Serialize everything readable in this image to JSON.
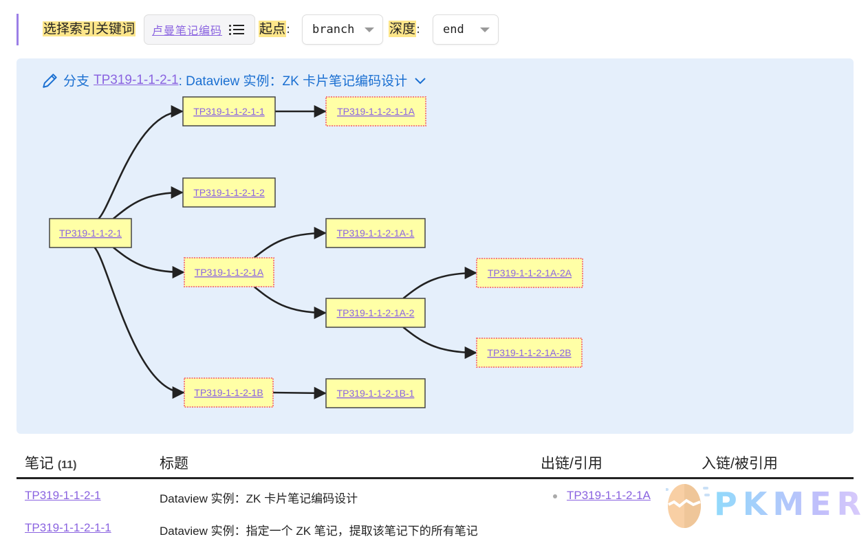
{
  "toolbar": {
    "keyword_label": "选择索引关键词",
    "keyword_value": "卢曼笔记编码",
    "start_label": "起点",
    "start_value": "branch",
    "depth_label": "深度",
    "depth_value": "end",
    "colon": ":",
    "list_icon": "list-icon"
  },
  "panel": {
    "prefix": "分支",
    "link": "TP319-1-1-2-1",
    "title": ": Dataview 实例：ZK 卡片笔记编码设计",
    "icons": {
      "edit": "pencil-icon",
      "expand": "chevron-down-icon"
    }
  },
  "graph": {
    "nodes": [
      {
        "id": "TP319-1-1-2-1",
        "label": "TP319-1-1-2-1",
        "dashed": false
      },
      {
        "id": "TP319-1-1-2-1-1",
        "label": "TP319-1-1-2-1-1",
        "dashed": false
      },
      {
        "id": "TP319-1-1-2-1-1A",
        "label": "TP319-1-1-2-1-1A",
        "dashed": true
      },
      {
        "id": "TP319-1-1-2-1-2",
        "label": "TP319-1-1-2-1-2",
        "dashed": false
      },
      {
        "id": "TP319-1-1-2-1A",
        "label": "TP319-1-1-2-1A",
        "dashed": true
      },
      {
        "id": "TP319-1-1-2-1A-1",
        "label": "TP319-1-1-2-1A-1",
        "dashed": false
      },
      {
        "id": "TP319-1-1-2-1A-2",
        "label": "TP319-1-1-2-1A-2",
        "dashed": false
      },
      {
        "id": "TP319-1-1-2-1A-2A",
        "label": "TP319-1-1-2-1A-2A",
        "dashed": true
      },
      {
        "id": "TP319-1-1-2-1A-2B",
        "label": "TP319-1-1-2-1A-2B",
        "dashed": true
      },
      {
        "id": "TP319-1-1-2-1B",
        "label": "TP319-1-1-2-1B",
        "dashed": true
      },
      {
        "id": "TP319-1-1-2-1B-1",
        "label": "TP319-1-1-2-1B-1",
        "dashed": false
      }
    ],
    "edges": [
      [
        "TP319-1-1-2-1",
        "TP319-1-1-2-1-1"
      ],
      [
        "TP319-1-1-2-1-1",
        "TP319-1-1-2-1-1A"
      ],
      [
        "TP319-1-1-2-1",
        "TP319-1-1-2-1-2"
      ],
      [
        "TP319-1-1-2-1",
        "TP319-1-1-2-1A"
      ],
      [
        "TP319-1-1-2-1A",
        "TP319-1-1-2-1A-1"
      ],
      [
        "TP319-1-1-2-1A",
        "TP319-1-1-2-1A-2"
      ],
      [
        "TP319-1-1-2-1A-2",
        "TP319-1-1-2-1A-2A"
      ],
      [
        "TP319-1-1-2-1A-2",
        "TP319-1-1-2-1A-2B"
      ],
      [
        "TP319-1-1-2-1",
        "TP319-1-1-2-1B"
      ],
      [
        "TP319-1-1-2-1B",
        "TP319-1-1-2-1B-1"
      ]
    ],
    "colors": {
      "fill": "#ffffa6",
      "border": "#444444",
      "dashed_border": "#f47c7c",
      "edge": "#222222",
      "text": "#8a63e0"
    }
  },
  "table": {
    "headers": {
      "note": "笔记",
      "count": "(11)",
      "title": "标题",
      "outlinks": "出链/引用",
      "inlinks": "入链/被引用"
    },
    "rows": [
      {
        "note": "TP319-1-1-2-1",
        "title": "Dataview 实例：ZK 卡片笔记编码设计",
        "outlinks": [
          "TP319-1-1-2-1A"
        ]
      },
      {
        "note": "TP319-1-1-2-1-1",
        "title": "Dataview 实例：指定一个 ZK 笔记，提取该笔记下的所有笔记",
        "outlinks": []
      }
    ]
  },
  "watermark": {
    "text": "PKMER"
  }
}
